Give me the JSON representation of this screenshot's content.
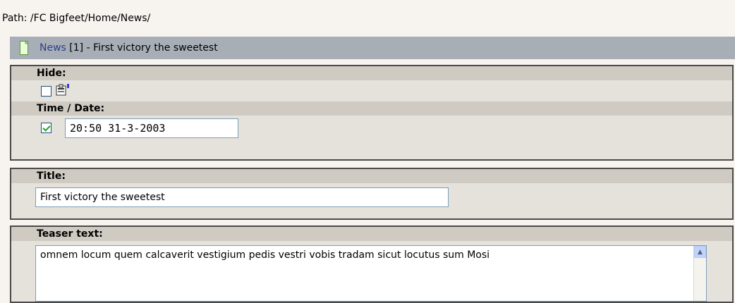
{
  "path": {
    "label": "Path: /FC Bigfeet/Home/News/"
  },
  "record_header": {
    "type": "News",
    "rest": " [1] - First victory the sweetest"
  },
  "fields": {
    "hide": {
      "label": "Hide:",
      "checked": false
    },
    "time_date": {
      "label": "Time / Date:",
      "checked": true,
      "value": "20:50 31-3-2003"
    },
    "title": {
      "label": "Title:",
      "value": "First victory the sweetest"
    },
    "teaser": {
      "label": "Teaser text:",
      "value": "omnem locum quem calcaverit vestigium pedis vestri vobis tradam sicut locutus sum Mosi"
    }
  },
  "icons": {
    "document": "document-icon",
    "properties": "record-properties-icon",
    "scroll_up": "scroll-up-arrow-icon"
  }
}
